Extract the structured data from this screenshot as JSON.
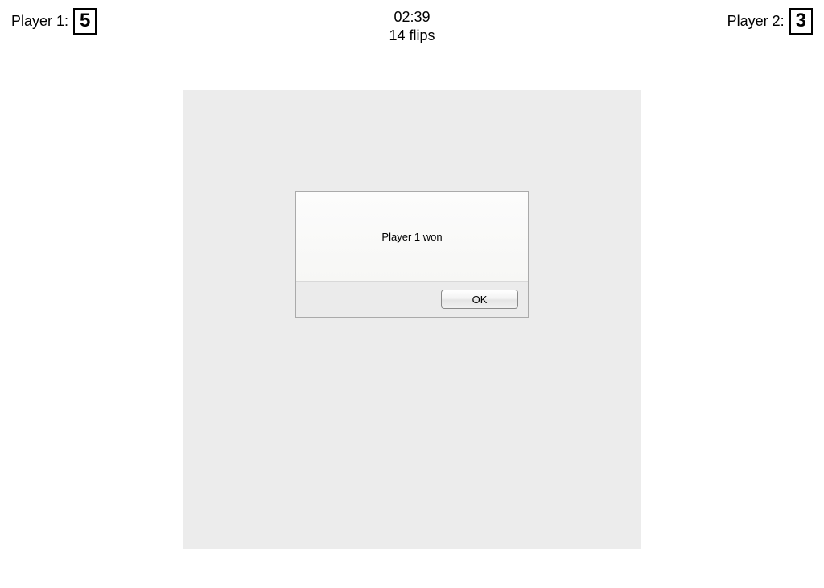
{
  "header": {
    "player1_label": "Player 1:",
    "player1_score": "5",
    "player2_label": "Player 2:",
    "player2_score": "3",
    "timer": "02:39",
    "flips": "14 flips"
  },
  "dialog": {
    "message": "Player 1 won",
    "ok_label": "OK"
  }
}
